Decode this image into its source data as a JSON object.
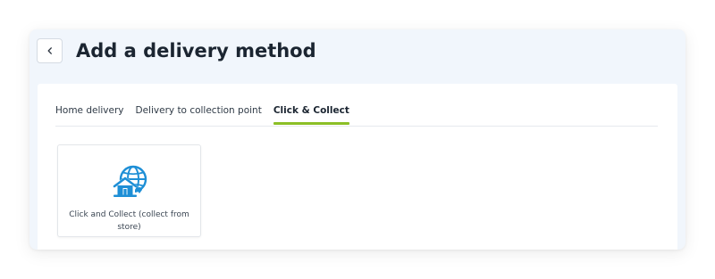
{
  "header": {
    "title": "Add a delivery method",
    "back_icon": "chevron-left-icon"
  },
  "tabs": [
    {
      "label": "Home delivery",
      "active": false
    },
    {
      "label": "Delivery to collection point",
      "active": false
    },
    {
      "label": "Click & Collect",
      "active": true
    }
  ],
  "methods": [
    {
      "label": "Click and Collect (collect from store)",
      "icon": "globe-store-icon"
    }
  ],
  "colors": {
    "accent": "#8cbf26",
    "icon_blue": "#1e8fd6",
    "title": "#1b2531",
    "header_bg": "#f1f6fc"
  }
}
